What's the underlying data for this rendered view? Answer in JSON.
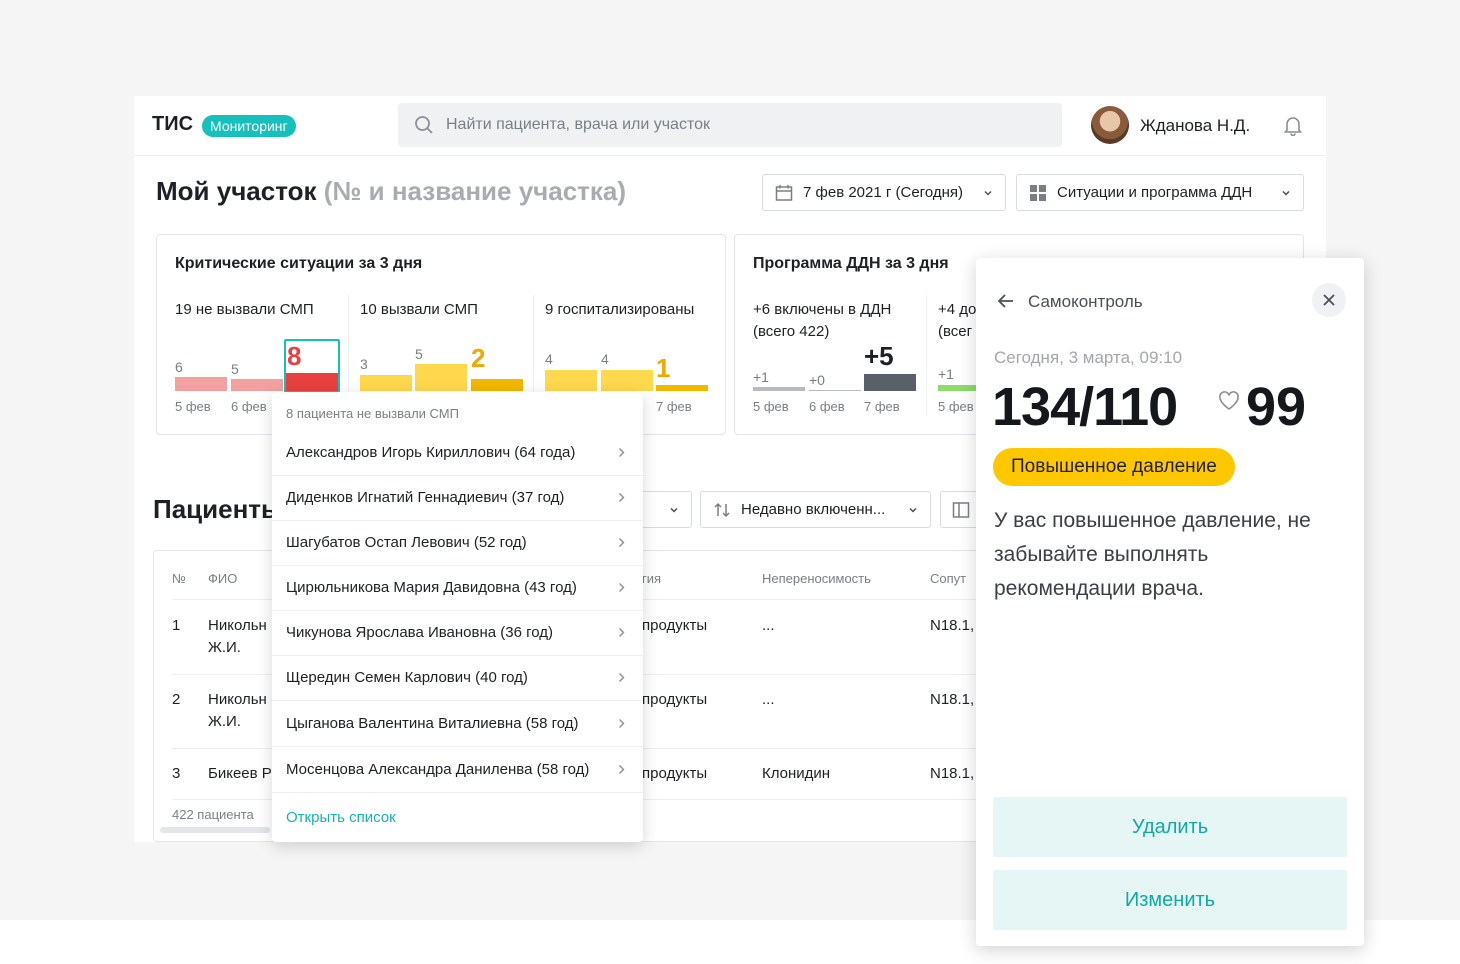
{
  "header": {
    "logo": "ТИС",
    "logo_badge": "Мониторинг",
    "search_placeholder": "Найти пациента, врача или участок",
    "user_name": "Жданова Н.Д."
  },
  "page": {
    "title": "Мой участок",
    "title_sub": "(№ и название участка)",
    "date_filter": "7 фев 2021 г (Сегодня)",
    "view_filter": "Ситуации и программа ДДН"
  },
  "critical_card": {
    "title": "Критические ситуации за 3 дня",
    "columns": [
      {
        "label": "19 не вызвали СМП",
        "values": [
          "6",
          "5",
          "8"
        ],
        "dates": [
          "5 фев",
          "6 фев",
          ""
        ]
      },
      {
        "label": "10 вызвали СМП",
        "values": [
          "3",
          "5",
          "2"
        ],
        "dates": [
          "",
          "",
          ""
        ]
      },
      {
        "label": "9 госпитализированы",
        "values": [
          "4",
          "4",
          "1"
        ],
        "dates": [
          "",
          "",
          "7 фев"
        ]
      }
    ]
  },
  "ddn_card": {
    "title": "Программа ДДН за 3 дня",
    "columns": [
      {
        "label_line1": "+6 включены в ДДН",
        "label_line2": "(всего 422)",
        "values": [
          "+1",
          "+0",
          "+5"
        ],
        "dates": [
          "5 фев",
          "6 фев",
          "7 фев"
        ]
      },
      {
        "label_line1": "+4 до",
        "label_line2": "(всег",
        "values": [
          "+1"
        ],
        "dates": [
          "5 фев"
        ]
      }
    ]
  },
  "patients": {
    "title": "Пациенты",
    "filter_tail": "р",
    "sort_label": "Недавно включенн...",
    "columns": [
      "№",
      "ФИО",
      "гия",
      "Непереносимость",
      "Сопут"
    ],
    "rows": [
      {
        "num": "1",
        "name_l1": "Никольн",
        "name_l2": "Ж.И.",
        "allergy": "продукты",
        "intolerance": "...",
        "comorbid": "N18.1,"
      },
      {
        "num": "2",
        "name_l1": "Никольн",
        "name_l2": "Ж.И.",
        "allergy": "продукты",
        "intolerance": "...",
        "comorbid": "N18.1,"
      },
      {
        "num": "3",
        "name_l1": "Бикеев Р",
        "name_l2": "",
        "allergy": "продукты",
        "intolerance": "Клонидин",
        "comorbid": "N18.1,"
      }
    ],
    "footer": "422 пациента"
  },
  "popup": {
    "header": "8 пациента не вызвали СМП",
    "items": [
      "Александров Игорь Кириллович (64 года)",
      "Диденков Игнатий Геннадиевич (37 год)",
      "Шагубатов Остап Левович (52 год)",
      "Цирюльникова Мария Давидовна (43 год)",
      "Чикунова Ярослава Ивановна (36 год)",
      "Щередин Семен Карлович (40 год)",
      "Цыганова Валентина Виталиевна (58 год)",
      "Мосенцова Александра Даниленва (58 год)"
    ],
    "link": "Открыть список"
  },
  "panel": {
    "title": "Самоконтроль",
    "date": "Сегодня, 3 марта, 09:10",
    "pressure": "134/110",
    "pulse": "99",
    "status": "Повышенное давление",
    "message": "У вас повышенное давление, не забывайте выполнять рекомендации врача.",
    "delete_label": "Удалить",
    "edit_label": "Изменить"
  },
  "colors": {
    "accent": "#16c0bd",
    "critical_red": "#e84141",
    "critical_pink": "#f2a0a0",
    "yellow": "#ffd84d",
    "orange": "#f2a800",
    "dark_bar": "#5a6069",
    "badge_yellow": "#ffc700"
  }
}
